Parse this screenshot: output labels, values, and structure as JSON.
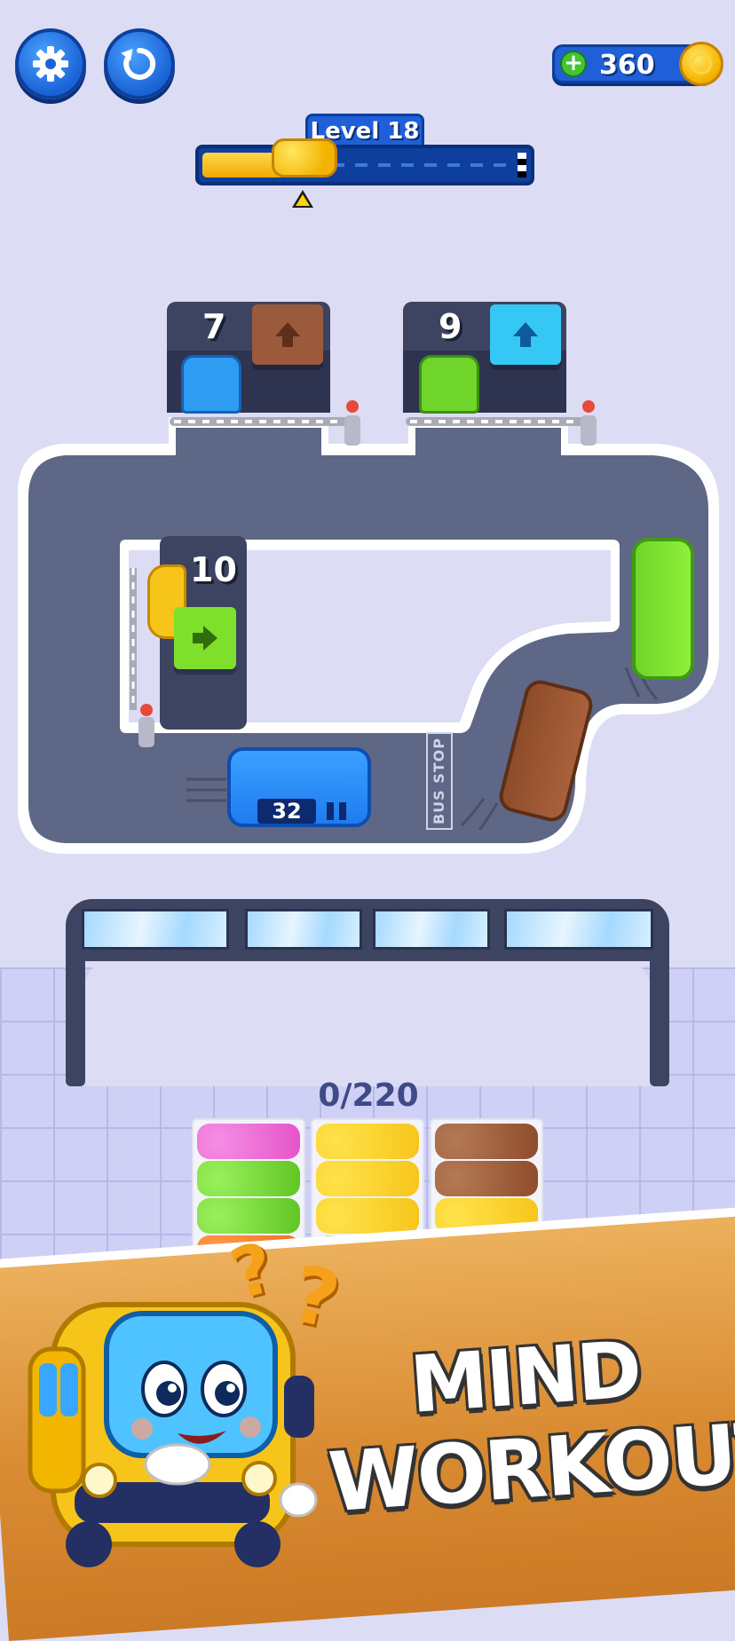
{
  "top_bar": {
    "settings_icon": "gear-icon",
    "restart_icon": "restart-icon",
    "coins": "360",
    "add_coins_icon": "plus-icon"
  },
  "level": {
    "label": "Level 18",
    "progress": 0.25
  },
  "garages": [
    {
      "count": "10",
      "arrow": "right",
      "color": "#7ee02a"
    },
    {
      "count": "7",
      "arrow": "up",
      "color": "#9b5a3c"
    },
    {
      "count": "9",
      "arrow": "up",
      "color": "#35c8f5"
    }
  ],
  "road": {
    "bus_number": "32",
    "bus_stop_label": "BUS STOP"
  },
  "passengers": {
    "counter": "0/220"
  },
  "banner": {
    "line1": "MIND",
    "line2": "WORKOUT!"
  },
  "colors": {
    "blue": "#1f7cf0",
    "green": "#7ee02a",
    "brown": "#8f4c2a",
    "yellow": "#f7c51a",
    "pink": "#f06ad6",
    "orange": "#f57c23",
    "road": "#5e6786"
  }
}
